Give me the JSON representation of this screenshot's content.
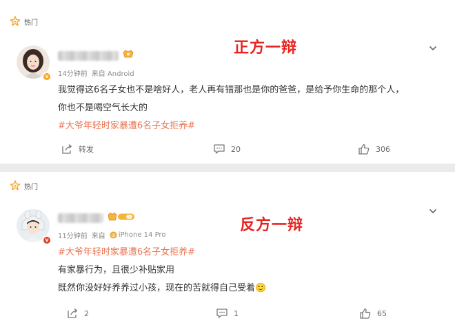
{
  "posts": [
    {
      "hot_label": "热门",
      "annotation": "正方一辩",
      "meta_time": "14分钟前",
      "meta_source": "来自 Android",
      "lines": [
        "我觉得这6名子女也不是啥好人，老人再有错那也是你的爸爸，是给予你生命的那个人，",
        "你也不是喝空气长大的"
      ],
      "hashtag": "#大爷年轻时家暴遭6名子女拒养#",
      "share_label": "转发",
      "comment_count": "20",
      "like_count": "306"
    },
    {
      "hot_label": "热门",
      "annotation": "反方一辩",
      "meta_time": "11分钟前",
      "meta_source": "来自",
      "meta_device": "iPhone 14 Pro",
      "hashtag": "#大爷年轻时家暴遭6名子女拒养#",
      "lines": [
        "有家暴行为，且很少补贴家用",
        "既然你没好好养养过小孩，现在的苦就得自己受着🙂"
      ],
      "share_count": "2",
      "comment_count": "1",
      "like_count": "65"
    }
  ],
  "colors": {
    "hashtag": "#eb7350",
    "annotation": "#e8231f",
    "hot_icon": "#f5a623",
    "background": "#ebebeb"
  }
}
